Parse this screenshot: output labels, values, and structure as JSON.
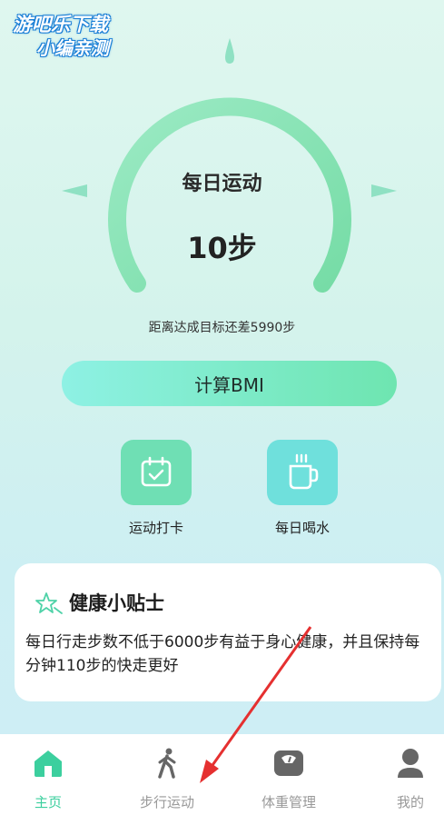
{
  "watermark": {
    "line1": "游吧乐下载",
    "line2": "小编亲测"
  },
  "gauge": {
    "title": "每日运动",
    "steps": "10步",
    "progress": 0.0017
  },
  "goal": {
    "remaining_text": "距离达成目标还差5990步"
  },
  "bmi_button": {
    "label": "计算BMI"
  },
  "features": [
    {
      "label": "运动打卡",
      "icon": "calendar-check-icon"
    },
    {
      "label": "每日喝水",
      "icon": "cup-icon"
    }
  ],
  "tips": {
    "title": "健康小贴士",
    "body": "每日行走步数不低于6000步有益于身心健康，并且保持每分钟110步的快走更好"
  },
  "nav": {
    "items": [
      {
        "label": "主页",
        "icon": "home-icon",
        "active": true
      },
      {
        "label": "步行运动",
        "icon": "walk-icon",
        "active": false
      },
      {
        "label": "体重管理",
        "icon": "scale-icon",
        "active": false
      },
      {
        "label": "我的",
        "icon": "user-icon",
        "active": false
      }
    ]
  },
  "colors": {
    "accent": "#3ccf9e",
    "arc": "#7ee0ad",
    "annotation": "#e53030"
  }
}
